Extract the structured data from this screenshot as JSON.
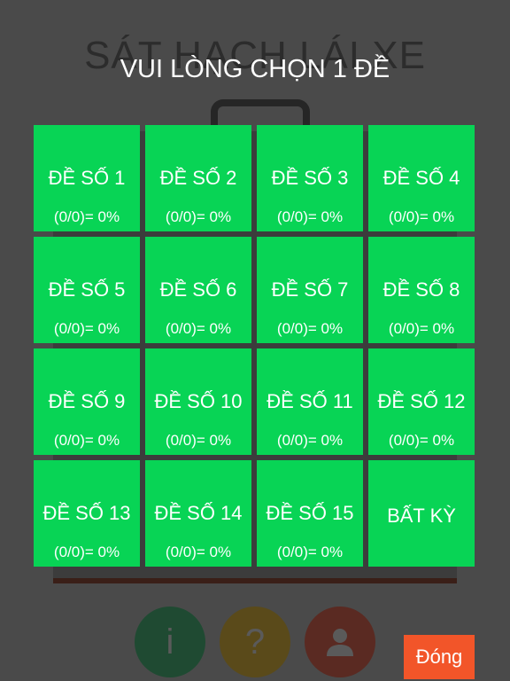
{
  "background": {
    "app_title": "SÁT HẠCH LÁI XE",
    "info_icon_glyph": "i",
    "help_icon_glyph": "?"
  },
  "modal": {
    "title": "VUI LÒNG CHỌN 1 ĐỀ",
    "tiles": [
      {
        "name": "ĐỀ SỐ 1",
        "score": "(0/0)= 0%"
      },
      {
        "name": "ĐỀ SỐ 2",
        "score": "(0/0)= 0%"
      },
      {
        "name": "ĐỀ SỐ 3",
        "score": "(0/0)= 0%"
      },
      {
        "name": "ĐỀ SỐ 4",
        "score": "(0/0)= 0%"
      },
      {
        "name": "ĐỀ SỐ 5",
        "score": "(0/0)= 0%"
      },
      {
        "name": "ĐỀ SỐ 6",
        "score": "(0/0)= 0%"
      },
      {
        "name": "ĐỀ SỐ 7",
        "score": "(0/0)= 0%"
      },
      {
        "name": "ĐỀ SỐ 8",
        "score": "(0/0)= 0%"
      },
      {
        "name": "ĐỀ SỐ 9",
        "score": "(0/0)= 0%"
      },
      {
        "name": "ĐỀ SỐ 10",
        "score": "(0/0)= 0%"
      },
      {
        "name": "ĐỀ SỐ 11",
        "score": "(0/0)= 0%"
      },
      {
        "name": "ĐỀ SỐ 12",
        "score": "(0/0)= 0%"
      },
      {
        "name": "ĐỀ SỐ 13",
        "score": "(0/0)= 0%"
      },
      {
        "name": "ĐỀ SỐ 14",
        "score": "(0/0)= 0%"
      },
      {
        "name": "ĐỀ SỐ 15",
        "score": "(0/0)= 0%"
      }
    ],
    "random_label": "BẤT KỲ",
    "close_label": "Đóng"
  },
  "colors": {
    "tile": "#08d455",
    "close_button": "#f25529",
    "overlay": "#4a4a4a"
  },
  "icons": {
    "info": "info-icon",
    "help": "help-icon",
    "user": "user-icon"
  }
}
